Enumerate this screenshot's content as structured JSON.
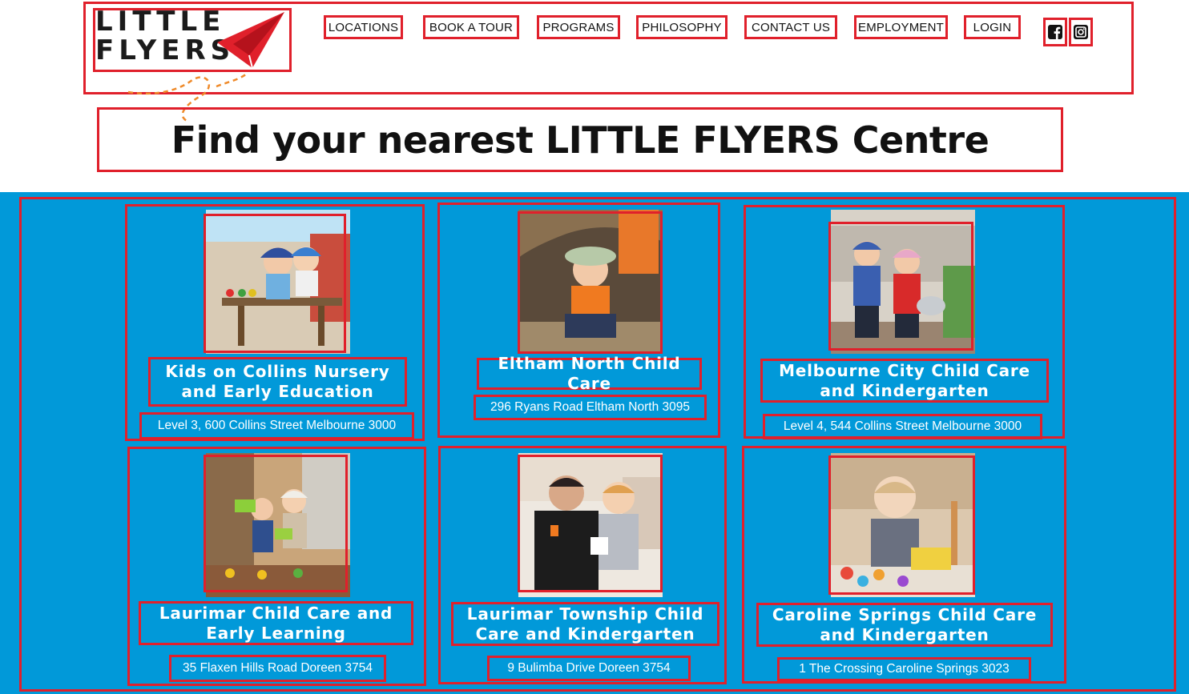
{
  "brand": {
    "logo_line1": "LITTLE",
    "logo_line2": "FLYERS",
    "red": "#e0202b",
    "blue": "#0199d9",
    "orange": "#ef8a2a"
  },
  "nav": {
    "items": [
      "LOCATIONS",
      "BOOK A TOUR",
      "PROGRAMS",
      "PHILOSOPHY",
      "CONTACT US",
      "EMPLOYMENT",
      "LOGIN"
    ],
    "social": [
      "facebook-icon",
      "instagram-icon"
    ]
  },
  "page": {
    "title": "Find your nearest LITTLE FLYERS Centre"
  },
  "centres": [
    {
      "name": "Kids on Collins Nursery and Early Education",
      "address": "Level 3, 600 Collins Street Melbourne 3000",
      "photo": "children-painting-photo"
    },
    {
      "name": "Eltham North Child Care",
      "address": "296 Ryans Road Eltham North 3095",
      "photo": "child-in-hideout-photo"
    },
    {
      "name": "Melbourne City Child Care and Kindergarten",
      "address": "Level 4, 544 Collins Street Melbourne 3000",
      "photo": "children-watering-plants-photo"
    },
    {
      "name": "Laurimar Child Care and Early Learning",
      "address": "35 Flaxen Hills Road Doreen 3754",
      "photo": "children-gardening-photo"
    },
    {
      "name": "Laurimar Township Child Care and Kindergarten",
      "address": "9 Bulimba Drive Doreen 3754",
      "photo": "educator-with-child-photo"
    },
    {
      "name": "Caroline Springs Child Care and Kindergarten",
      "address": "1 The Crossing Caroline Springs 3023",
      "photo": "toddler-playing-photo"
    }
  ]
}
